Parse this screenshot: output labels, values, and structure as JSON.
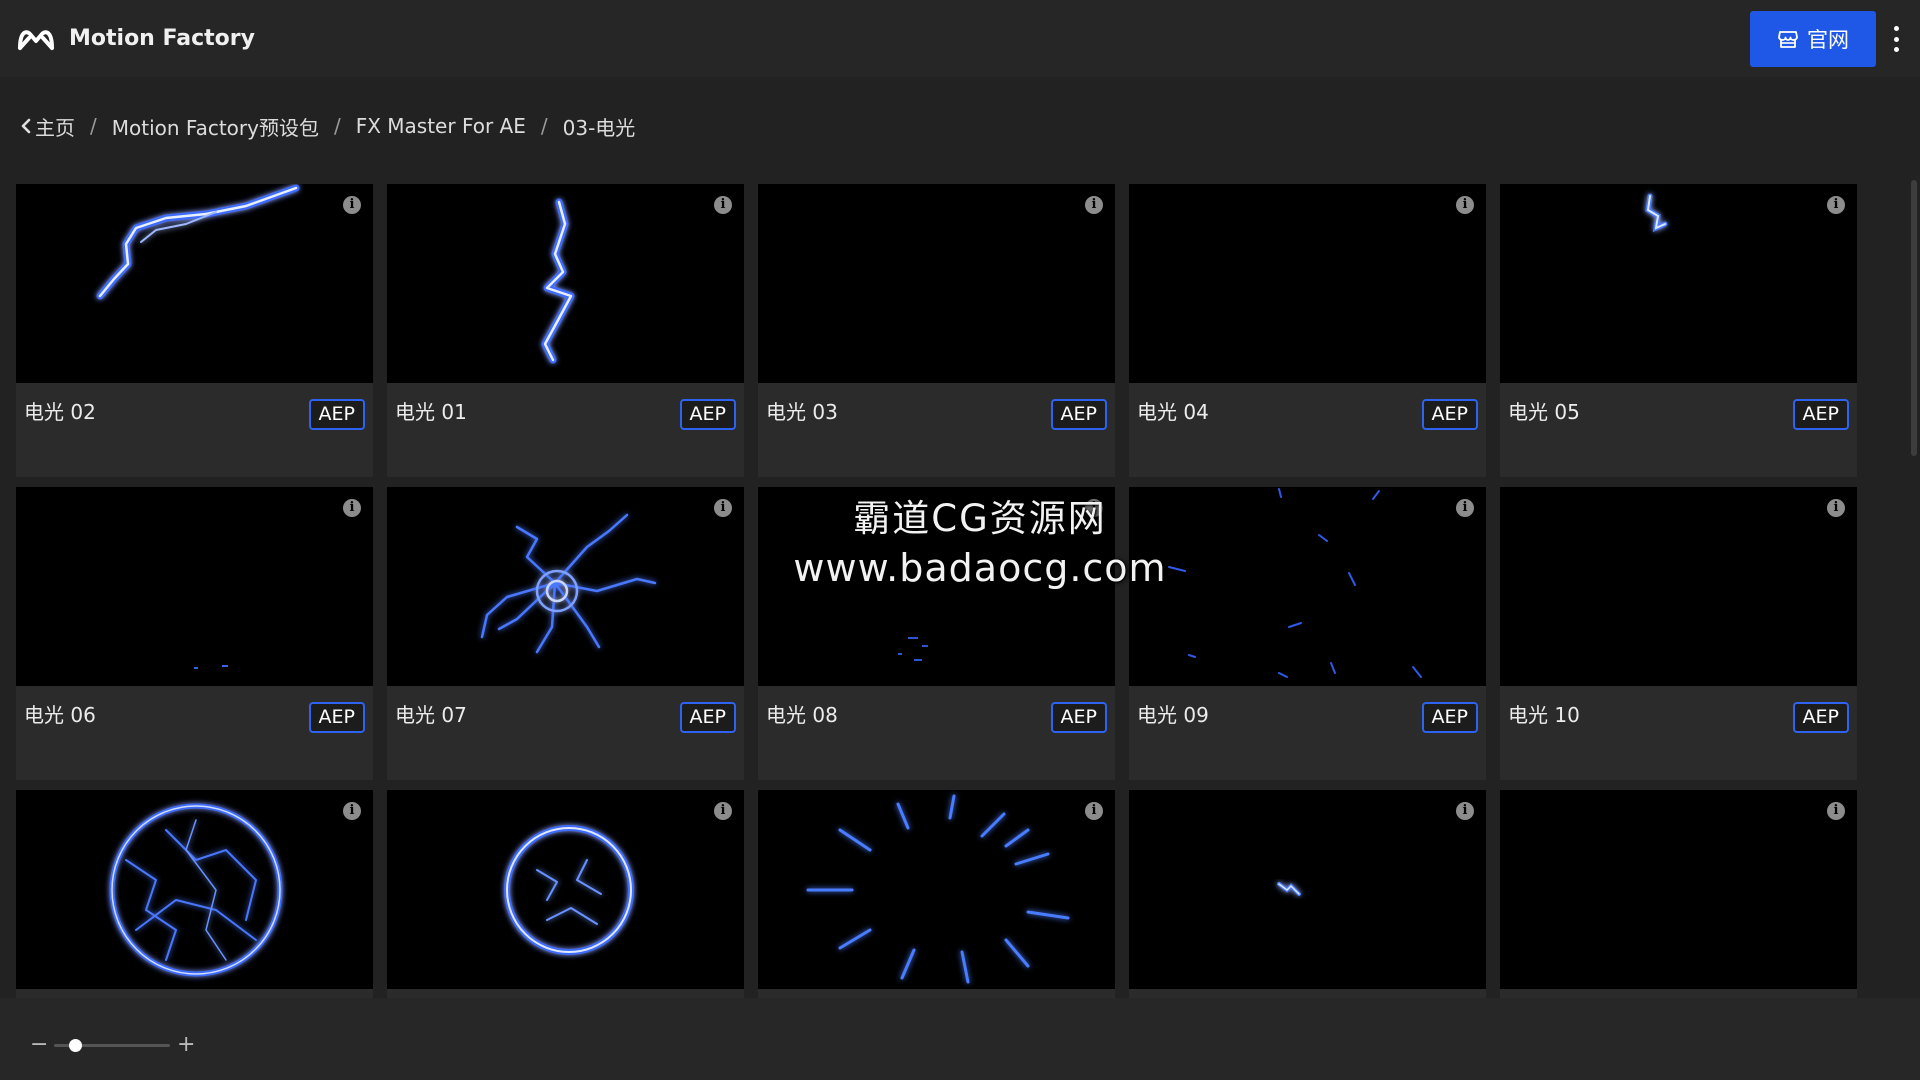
{
  "app": {
    "name": "Motion Factory",
    "logo_icon": "motion-factory-logo-icon"
  },
  "header": {
    "site_button_label": "官网",
    "site_button_icon": "store-icon",
    "more_icon": "more-vertical-icon",
    "accent_color": "#1f57e7"
  },
  "breadcrumb": {
    "back_icon": "chevron-left-icon",
    "items": [
      "主页",
      "Motion Factory预设包",
      "FX Master For AE",
      "03-电光"
    ]
  },
  "grid": {
    "badge_color": "#2e62f0",
    "items": [
      {
        "title": "电光 02",
        "format": "AEP",
        "preview": "bolt-arc"
      },
      {
        "title": "电光 01",
        "format": "AEP",
        "preview": "bolt-vertical"
      },
      {
        "title": "电光 03",
        "format": "AEP",
        "preview": "empty"
      },
      {
        "title": "电光 04",
        "format": "AEP",
        "preview": "empty"
      },
      {
        "title": "电光 05",
        "format": "AEP",
        "preview": "small-spark"
      },
      {
        "title": "电光 06",
        "format": "AEP",
        "preview": "low-specks"
      },
      {
        "title": "电光 07",
        "format": "AEP",
        "preview": "burst"
      },
      {
        "title": "电光 08",
        "format": "AEP",
        "preview": "faint-specks"
      },
      {
        "title": "电光 09",
        "format": "AEP",
        "preview": "scattered"
      },
      {
        "title": "电光 10",
        "format": "AEP",
        "preview": "empty"
      },
      {
        "title": "",
        "format": "",
        "preview": "plasma-sphere"
      },
      {
        "title": "",
        "format": "",
        "preview": "plasma-ring"
      },
      {
        "title": "",
        "format": "",
        "preview": "radial-rays"
      },
      {
        "title": "",
        "format": "",
        "preview": "tiny-spark"
      },
      {
        "title": "",
        "format": "",
        "preview": "empty"
      }
    ]
  },
  "watermark": {
    "line1": "霸道CG资源网",
    "line2": "www.badaocg.com"
  },
  "zoom": {
    "minus_label": "−",
    "plus_label": "+",
    "level": 0.18
  }
}
